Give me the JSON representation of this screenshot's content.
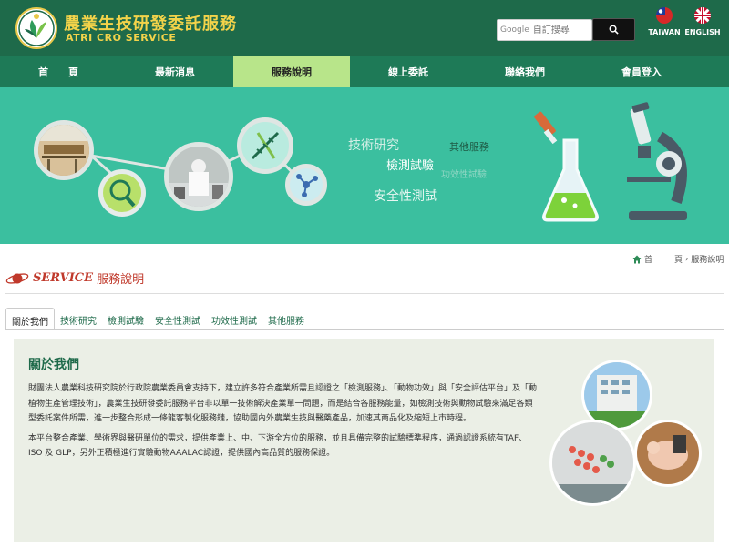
{
  "header": {
    "title": "農業生技研發委託服務",
    "subtitle": "ATRI CRO SERVICE",
    "search": {
      "brand": "Google",
      "placeholder": "自訂搜尋",
      "value": ""
    },
    "languages": [
      {
        "label": "TAIWAN"
      },
      {
        "label": "ENGLISH"
      }
    ]
  },
  "nav": {
    "items": [
      {
        "label": "首　　頁"
      },
      {
        "label": "最新消息"
      },
      {
        "label": "服務說明"
      },
      {
        "label": "線上委託"
      },
      {
        "label": "聯絡我們"
      },
      {
        "label": "會員登入"
      }
    ],
    "active_index": 2,
    "active_color": "#b8e58a"
  },
  "banner": {
    "words": [
      "技術研究",
      "其他服務",
      "檢測試驗",
      "功效性試驗",
      "安全性測試"
    ],
    "bg_color": "#3bbf9f"
  },
  "breadcrumb": {
    "home": "首",
    "separator": "頁",
    "current": "服務說明"
  },
  "section": {
    "title_en": "SERVICE",
    "title_zh": "服務說明"
  },
  "tabs": [
    {
      "label": "關於我們"
    },
    {
      "label": "技術研究"
    },
    {
      "label": "檢測試驗"
    },
    {
      "label": "安全性測試"
    },
    {
      "label": "功效性測試"
    },
    {
      "label": "其他服務"
    }
  ],
  "panel": {
    "title": "關於我們",
    "paragraph1": "財團法人農業科技研究院於行政院農業委員會支持下，建立許多符合產業所需且認證之「檢測服務」、「動物功效」與「安全評估平台」及「動植物生產管理技術」，農業生技研發委託服務平台非以單一技術解決產業單一問題，而是結合各服務能量，如檢測技術與動物試驗來滿足各類型委託案件所需，進一步整合形成一條龍客製化服務鏈，協助國內外農業生技與醫藥產品，加速其商品化及縮短上市時程。",
    "paragraph2": "本平台整合產業、學術界與醫研單位的需求，提供產業上、中、下游全方位的服務，並且具備完整的試驗標準程序，通過認證系統有TAF、ISO 及 GLP，另外正積極進行實驗動物AAALAC認證，提供國內高品質的服務保證。"
  },
  "colors": {
    "header_bg": "#1e6a4a",
    "nav_bg": "#1e7a57",
    "title_gold": "#f3d34a",
    "accent_red": "#c0392b",
    "panel_bg": "#ebefe6"
  }
}
